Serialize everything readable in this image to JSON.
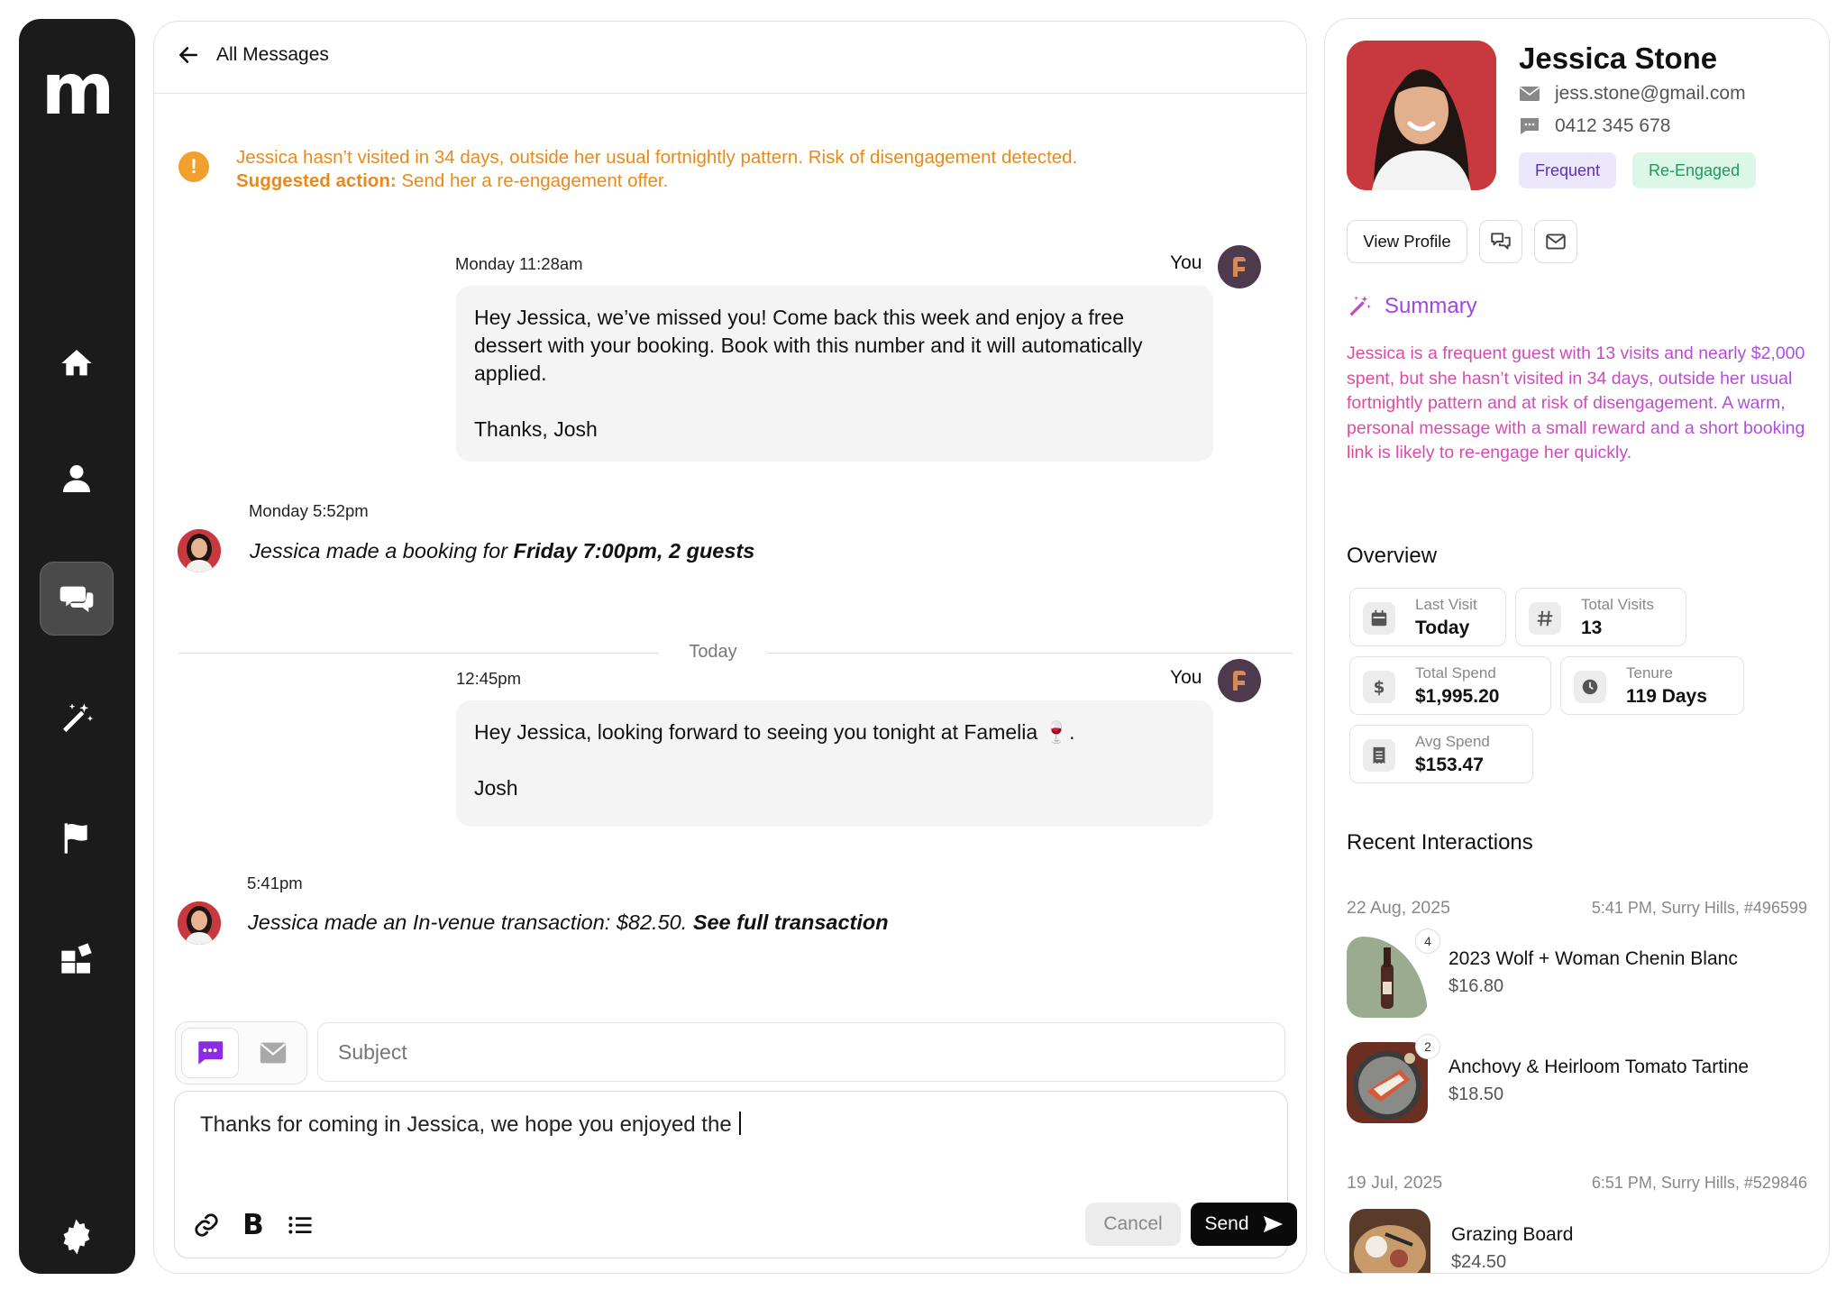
{
  "app": {
    "logo": "m",
    "nav": [
      "home",
      "customers",
      "messages",
      "magic",
      "campaigns",
      "widgets",
      "settings"
    ],
    "active_nav": "messages"
  },
  "header": {
    "back_label": "All Messages"
  },
  "alert": {
    "text": "Jessica hasn’t visited in 34 days, outside her usual fortnightly pattern. Risk of disengagement detected.",
    "suggested_label": "Suggested action:",
    "suggested_text": " Send her a re-engagement offer.",
    "color": "#e88a1a"
  },
  "thread": {
    "sender_label": "You",
    "msg1": {
      "time": "Monday 11:28am",
      "body": "Hey Jessica, we’ve missed you! Come back this week and enjoy a free dessert with your booking. Book with this number and it will automatically applied.\n\nThanks, Josh"
    },
    "event1": {
      "time": "Monday 5:52pm",
      "prefix": "Jessica made a booking for ",
      "bold": "Friday 7:00pm, 2 guests"
    },
    "divider": "Today",
    "msg2": {
      "time": "12:45pm",
      "body": "Hey Jessica, looking forward to seeing you tonight at Famelia 🍷.\n\nJosh"
    },
    "event2": {
      "time": "5:41pm",
      "prefix": "Jessica made an In-venue transaction: $82.50. ",
      "bold": "See full transaction"
    }
  },
  "composer": {
    "subject_placeholder": "Subject",
    "draft": "Thanks for coming in Jessica, we hope you enjoyed the ",
    "cancel_label": "Cancel",
    "send_label": "Send"
  },
  "profile": {
    "name": "Jessica Stone",
    "email": "jess.stone@gmail.com",
    "phone": "0412 345 678",
    "tags": [
      "Frequent",
      "Re-Engaged"
    ],
    "view_profile_label": "View Profile",
    "summary_title": "Summary",
    "summary_text": "Jessica is a frequent guest with 13 visits and nearly $2,000 spent, but she hasn’t visited in 34 days, outside her usual fortnightly pattern and at risk of disengagement. A warm, personal message with a small reward and a short booking link is likely to re-engage her quickly."
  },
  "overview": {
    "title": "Overview",
    "last_visit": {
      "label": "Last Visit",
      "value": "Today"
    },
    "total_visits": {
      "label": "Total Visits",
      "value": "13"
    },
    "total_spend": {
      "label": "Total Spend",
      "value": "$1,995.20"
    },
    "tenure": {
      "label": "Tenure",
      "value": "119 Days"
    },
    "avg_spend": {
      "label": "Avg Spend",
      "value": "$153.47"
    }
  },
  "interactions": {
    "title": "Recent Interactions",
    "groups": [
      {
        "date": "22 Aug, 2025",
        "meta": "5:41 PM, Surry Hills, #496599",
        "items": [
          {
            "qty": "4",
            "name": "2023 Wolf + Woman Chenin Blanc",
            "price": "$16.80"
          },
          {
            "qty": "2",
            "name": "Anchovy & Heirloom Tomato Tartine",
            "price": "$18.50"
          }
        ]
      },
      {
        "date": "19 Jul, 2025",
        "meta": "6:51 PM, Surry Hills, #529846",
        "items": [
          {
            "name": "Grazing Board",
            "price": "$24.50"
          }
        ]
      }
    ]
  }
}
